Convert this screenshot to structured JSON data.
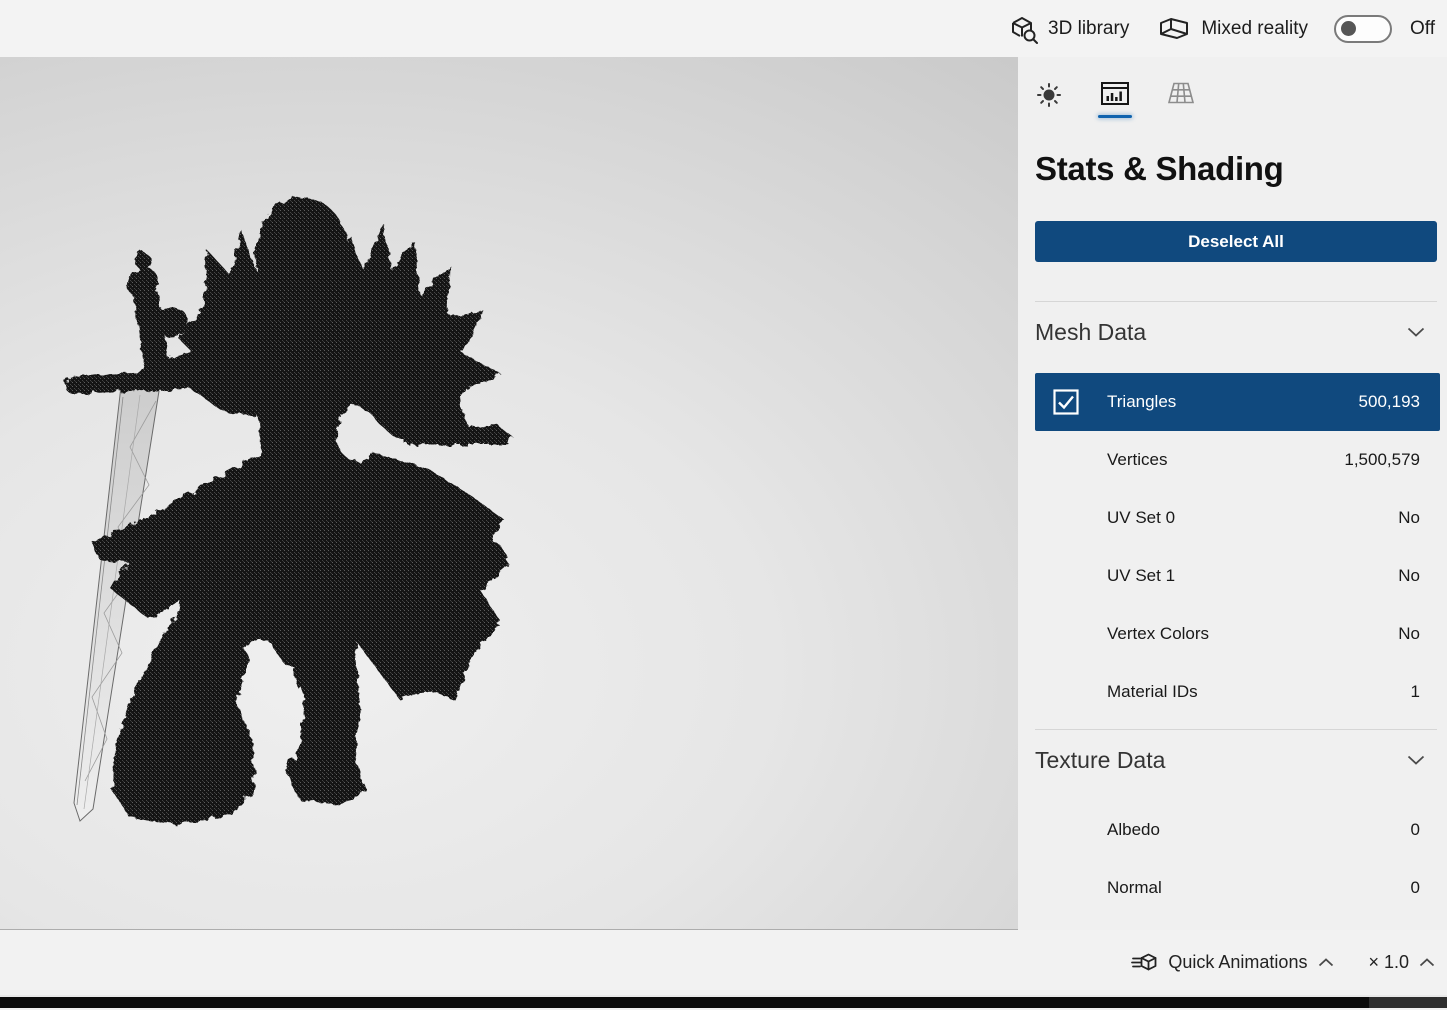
{
  "topbar": {
    "library_label": "3D library",
    "mixed_reality_label": "Mixed reality",
    "toggle_state_label": "Off"
  },
  "panel": {
    "title": "Stats & Shading",
    "deselect_button_label": "Deselect All",
    "tabs": [
      {
        "name": "environment-lighting",
        "icon": "sun-icon",
        "active": false
      },
      {
        "name": "stats-shading",
        "icon": "stats-icon",
        "active": true
      },
      {
        "name": "grid-views",
        "icon": "grid-icon",
        "active": false
      }
    ],
    "mesh": {
      "section_label": "Mesh Data",
      "rows": [
        {
          "label": "Triangles",
          "value": "500,193",
          "checked": true,
          "selected": true
        },
        {
          "label": "Vertices",
          "value": "1,500,579"
        },
        {
          "label": "UV Set 0",
          "value": "No"
        },
        {
          "label": "UV Set 1",
          "value": "No"
        },
        {
          "label": "Vertex Colors",
          "value": "No"
        },
        {
          "label": "Material IDs",
          "value": "1"
        }
      ]
    },
    "texture": {
      "section_label": "Texture Data",
      "rows": [
        {
          "label": "Albedo",
          "value": "0"
        },
        {
          "label": "Normal",
          "value": "0"
        }
      ]
    }
  },
  "bottombar": {
    "quick_animations_label": "Quick Animations",
    "playback_speed": "× 1.0"
  },
  "colors": {
    "accent_blue": "#10497e",
    "tab_underline_blue": "#0f63ae",
    "viewport_background_center": "#efefef",
    "viewport_background_edge": "#c7c7c7",
    "model_silhouette": "#141414",
    "sword_blade": "#e0e0e0"
  }
}
